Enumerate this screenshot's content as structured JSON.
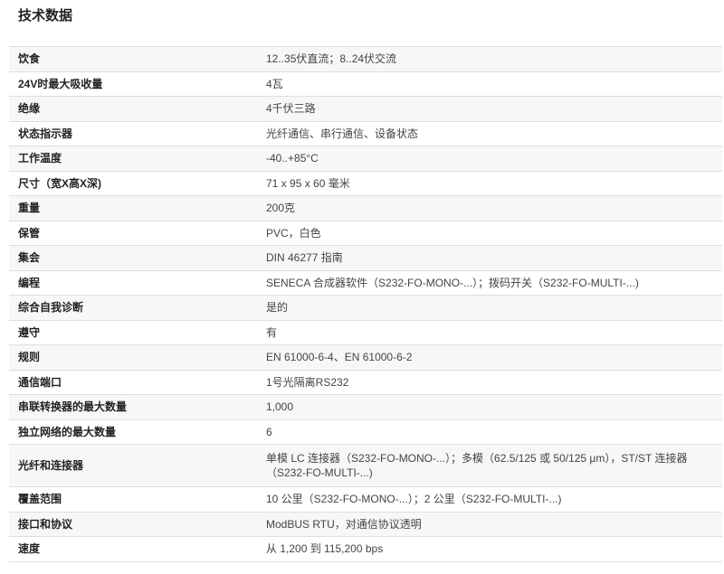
{
  "section": {
    "title": "技术数据"
  },
  "specs": [
    {
      "label": "饮食",
      "value": "12..35伏直流；8..24伏交流"
    },
    {
      "label": "24V时最大吸收量",
      "value": "4瓦"
    },
    {
      "label": "绝缘",
      "value": "4千伏三路"
    },
    {
      "label": "状态指示器",
      "value": "光纤通信、串行通信、设备状态"
    },
    {
      "label": "工作温度",
      "value": "-40..+85°C"
    },
    {
      "label": "尺寸（宽X高X深)",
      "value": "71 x 95 x 60 毫米"
    },
    {
      "label": "重量",
      "value": "200克"
    },
    {
      "label": "保管",
      "value": "PVC，白色"
    },
    {
      "label": "集会",
      "value": "DIN 46277 指南"
    },
    {
      "label": "编程",
      "value": "SENECA 合成器软件（S232-FO-MONO-...）；拨码开关（S232-FO-MULTI-...)"
    },
    {
      "label": "综合自我诊断",
      "value": "是的"
    },
    {
      "label": "遵守",
      "value": "有"
    },
    {
      "label": "规则",
      "value": "EN 61000-6-4、EN 61000-6-2"
    },
    {
      "label": "通信端口",
      "value": "1号光隔离RS232"
    },
    {
      "label": "串联转换器的最大数量",
      "value": "1,000"
    },
    {
      "label": "独立网络的最大数量",
      "value": "6"
    },
    {
      "label": "光纤和连接器",
      "value": "单模 LC 连接器（S232-FO-MONO-...）；多模（62.5/125 或 50/125 μm），ST/ST 连接器（S232-FO-MULTI-...)"
    },
    {
      "label": "覆盖范围",
      "value": "10 公里（S232-FO-MONO-...）；2 公里（S232-FO-MULTI-...)"
    },
    {
      "label": "接口和协议",
      "value": "ModBUS RTU，对通信协议透明"
    },
    {
      "label": "速度",
      "value": "从 1,200 到 115,200 bps"
    }
  ]
}
